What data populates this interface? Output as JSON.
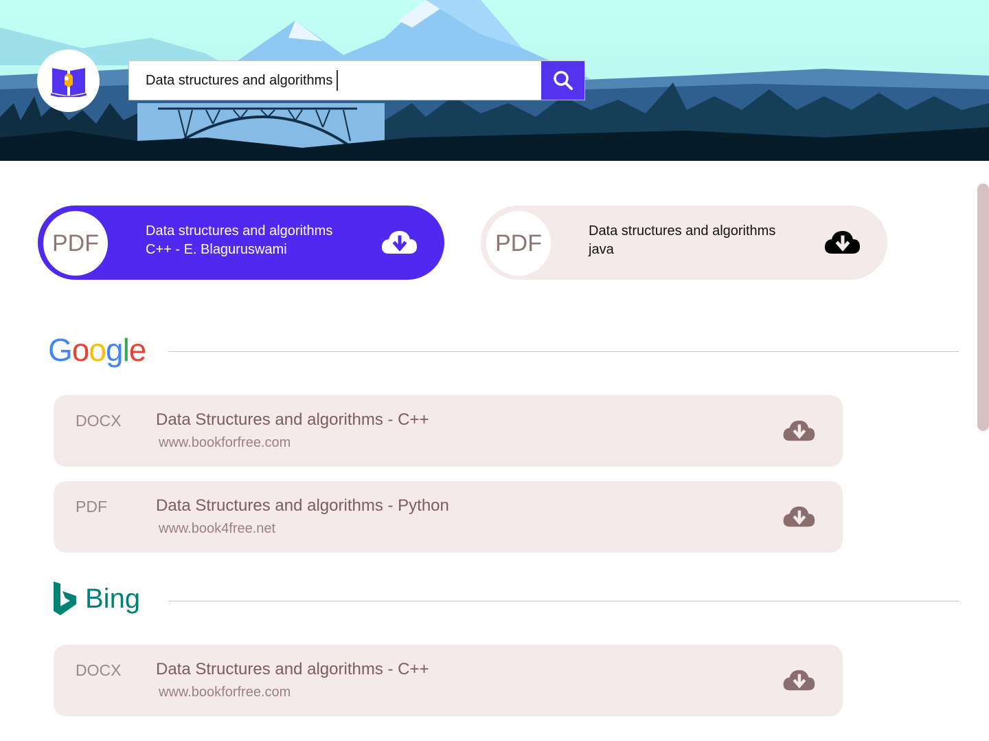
{
  "header": {
    "logo_icon": "open-book-icon",
    "search": {
      "value": "Data structures and algorithms",
      "icon": "search-icon",
      "button_color": "#5433f0"
    }
  },
  "featured": [
    {
      "format": "PDF",
      "title": "Data structures and algorithms",
      "subtitle": "C++ - E. Blaguruswami",
      "icon": "cloud-download-icon",
      "style": "active",
      "color": "#5029f1"
    },
    {
      "format": "PDF",
      "title": "Data structures and algorithms",
      "subtitle": "java",
      "icon": "cloud-download-icon",
      "style": "inactive",
      "color": "#f4eaea"
    }
  ],
  "sections": [
    {
      "source": "Google",
      "results": [
        {
          "format": "DOCX",
          "title": "Data Structures and algorithms - C++",
          "url": "www.bookforfree.com",
          "icon": "cloud-download-icon"
        },
        {
          "format": "PDF",
          "title": "Data Structures and algorithms - Python",
          "url": "www.book4free.net",
          "icon": "cloud-download-icon"
        }
      ]
    },
    {
      "source": "Bing",
      "results": [
        {
          "format": "DOCX",
          "title": "Data Structures and algorithms - C++",
          "url": "www.bookforfree.com",
          "icon": "cloud-download-icon"
        }
      ]
    }
  ],
  "colors": {
    "accent": "#5029f1",
    "card_bg": "#f4eaea",
    "bing_green": "#008373"
  }
}
